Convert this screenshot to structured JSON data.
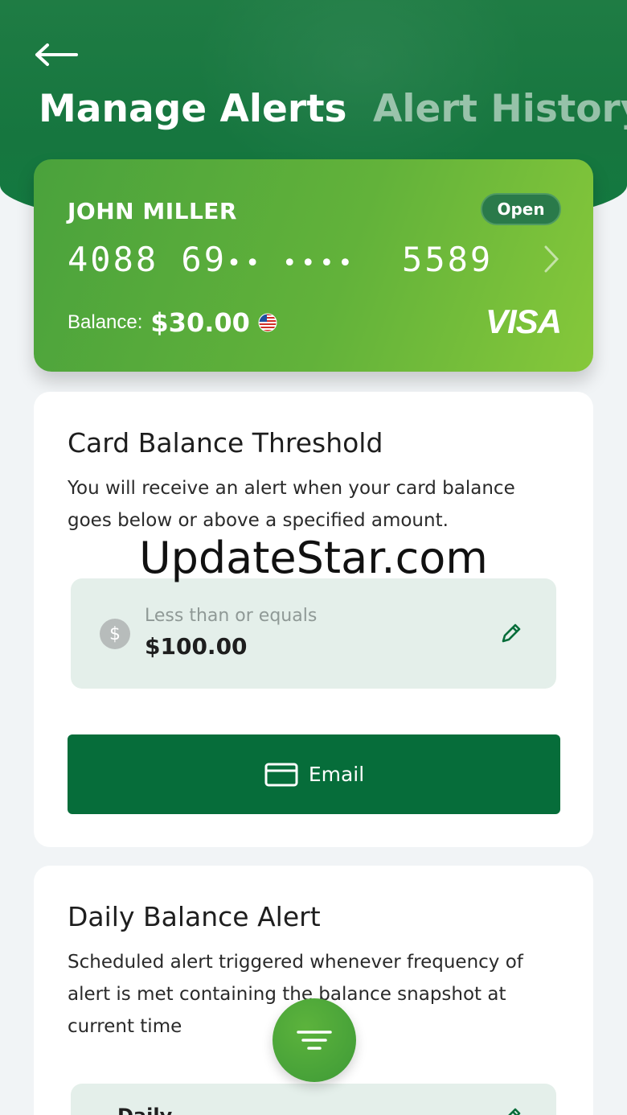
{
  "header": {
    "tabs": [
      {
        "label": "Manage Alerts",
        "active": true
      },
      {
        "label": "Alert History",
        "active": false
      }
    ],
    "back_icon": "arrow-left-icon"
  },
  "card": {
    "holder": "JOHN MILLER",
    "status": "Open",
    "number_start": "4088 69",
    "number_masked": "•• ••••",
    "number_end": "5589",
    "balance_label": "Balance:",
    "balance_amount": "$30.00",
    "currency_icon": "us-flag-icon",
    "network": "VISA",
    "colors": {
      "gradient_start": "#4aa23c",
      "gradient_end": "#86c83a"
    }
  },
  "threshold_alert": {
    "title": "Card Balance Threshold",
    "description": "You will receive an alert when your card balance goes below or above a specified amount.",
    "condition_label": "Less than or equals",
    "condition_value": "$100.00",
    "channel_button": "Email"
  },
  "daily_alert": {
    "title": "Daily Balance Alert",
    "description": "Scheduled alert triggered whenever frequency of alert is met containing the balance snapshot at current time",
    "frequency_value": "Daily"
  },
  "watermark": "UpdateStar.com",
  "colors": {
    "primary": "#066d3a",
    "header": "#1a7a43",
    "accent": "#5cb33c"
  }
}
